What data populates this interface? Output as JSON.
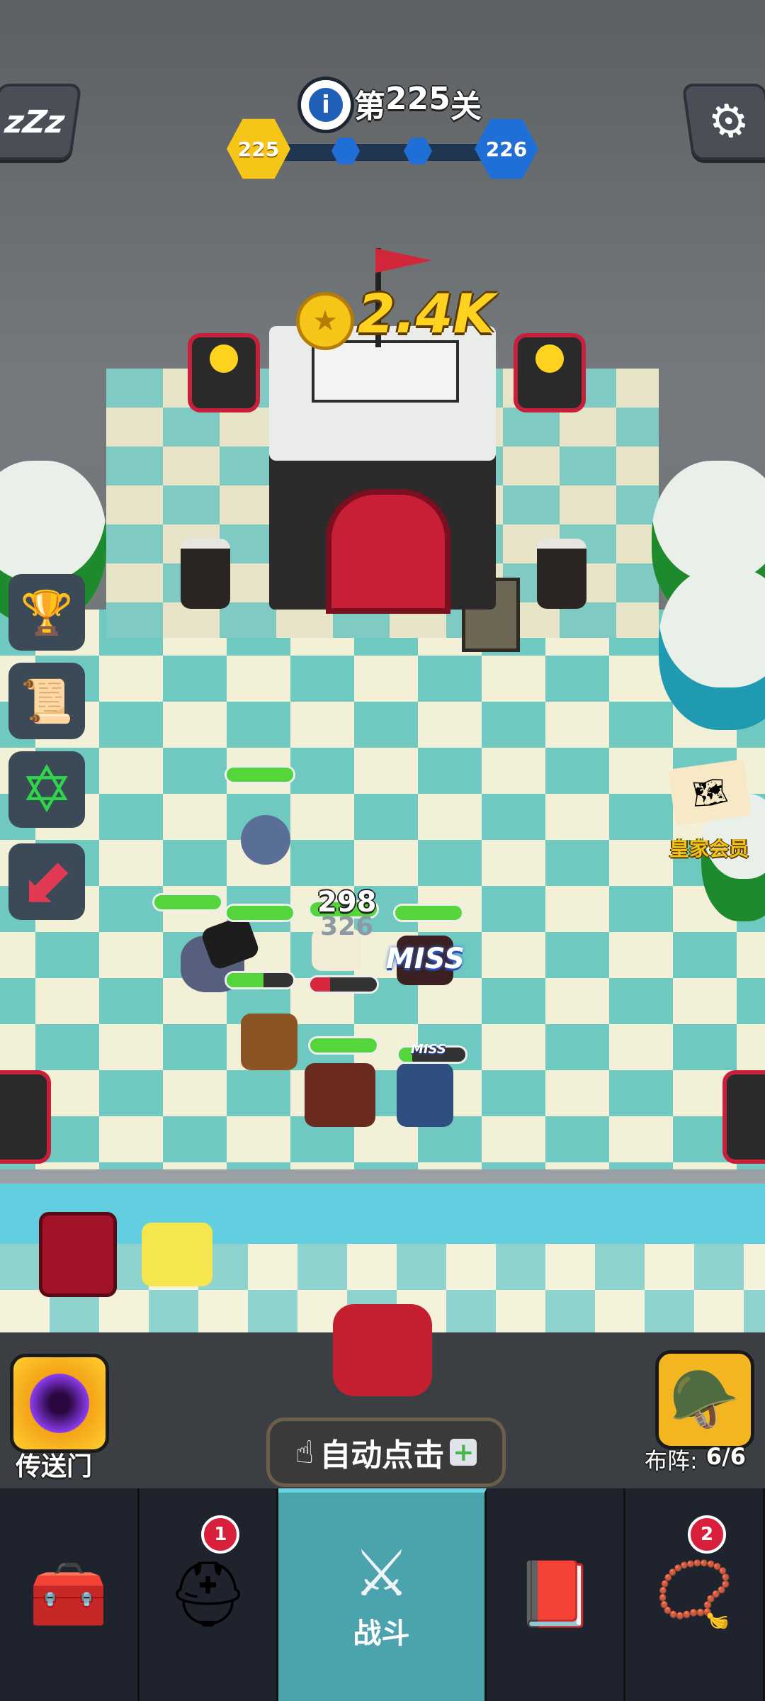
{
  "level": {
    "prefix": "第",
    "number": "225",
    "suffix": "关",
    "current": "225",
    "next": "226",
    "progress_dots": 2
  },
  "coin_reward": "2.4K",
  "battle_text": {
    "damage_1": "298",
    "damage_2": "326",
    "miss_big": "MISS",
    "miss_small": "MISS"
  },
  "side_menu": {
    "royal_member_label": "皇家会员"
  },
  "bottom_controls": {
    "portal_label": "传送门",
    "auto_click_label": "自动点击",
    "formation_label": "布阵:",
    "formation_value": "6/6"
  },
  "nav": {
    "battle_label": "战斗",
    "heroes_badge": "1",
    "equipment_badge": "2"
  },
  "icons": {
    "sleep": "zzz-icon",
    "settings": "gear-icon",
    "info": "info-icon",
    "coin": "coin-icon",
    "plus": "plus-icon",
    "hand": "pointer-hand-icon"
  },
  "colors": {
    "level_current": "#f5c518",
    "level_next": "#1f6fd6",
    "miss": "#3b6fe0",
    "nav_active": "#4aa3ad",
    "badge": "#d81f3c",
    "royal_text": "#f0c21a"
  }
}
